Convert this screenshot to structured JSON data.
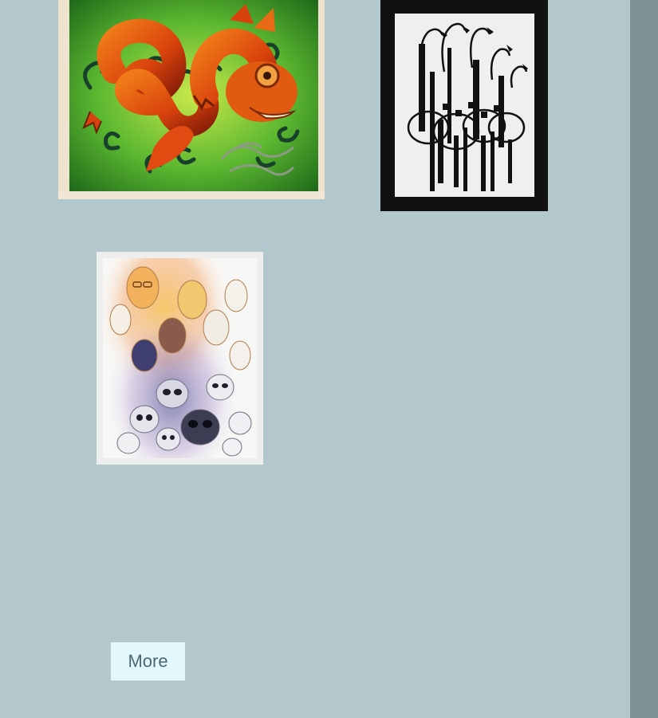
{
  "gallery": {
    "items": [
      {
        "name": "dragon-painting"
      },
      {
        "name": "flamingos-drawing"
      },
      {
        "name": "faces-and-skulls-drawing"
      }
    ],
    "more_label": "More"
  },
  "colors": {
    "background": "#b3c8cd",
    "right_rail": "#7f9296",
    "button_background": "#e2f8fd",
    "button_text": "#4b6771"
  }
}
